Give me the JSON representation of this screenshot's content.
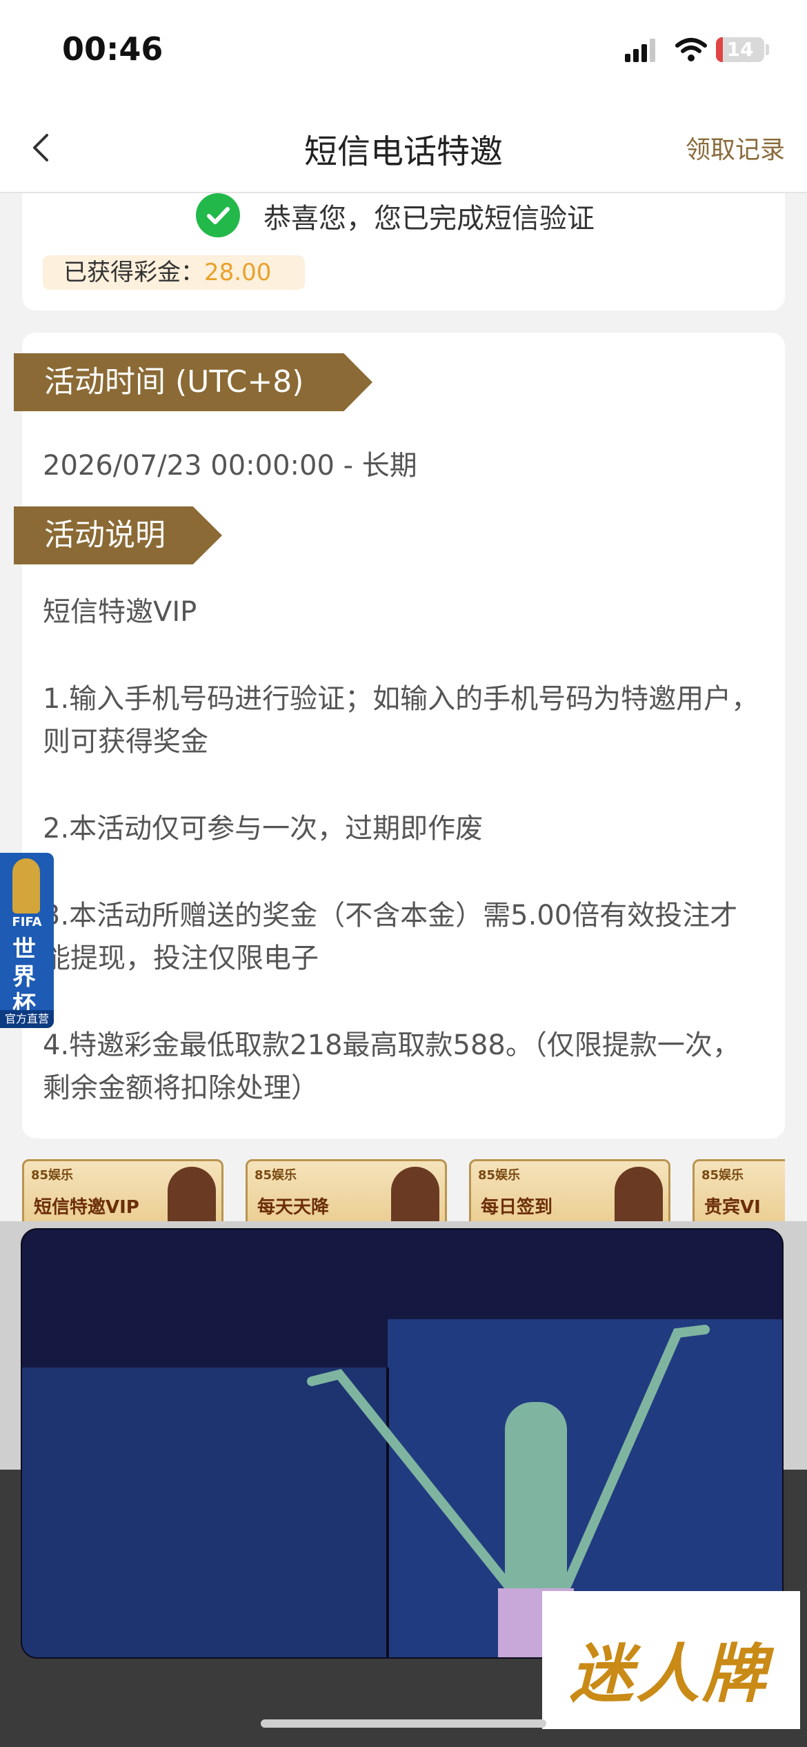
{
  "status_bar": {
    "time": "00:46",
    "battery": "14",
    "battery_level": 0.14
  },
  "nav": {
    "title": "短信电话特邀",
    "right_link": "领取记录"
  },
  "verification": {
    "message": "恭喜您，您已完成短信验证",
    "earned_label": "已获得彩金：",
    "earned_amount": "28.00"
  },
  "activity": {
    "time_heading": "活动时间 (UTC+8)",
    "time_range": "2026/07/23 00:00:00 - 长期",
    "desc_heading": "活动说明",
    "desc_lines": [
      "短信特邀VIP",
      "1.输入手机号码进行验证；如输入的手机号码为特邀用户，则可获得奖金",
      "2.本活动仅可参与一次，过期即作废",
      "3.本活动所赠送的奖金（不含本金）需5.00倍有效投注才能提现，投注仅限电子",
      "4.特邀彩金最低取款218最高取款588。（仅限提款一次，剩余金额将扣除处理）"
    ]
  },
  "floating_ad": {
    "label_top": "FIFA",
    "label_main": "世界杯",
    "label_bottom": "官方直营"
  },
  "banners": [
    {
      "brand": "85娱乐",
      "title": "短信特邀VIP"
    },
    {
      "brand": "85娱乐",
      "title": "每天天降"
    },
    {
      "brand": "85娱乐",
      "title": "每日签到"
    },
    {
      "brand": "85娱乐",
      "title": "贵宾VI"
    }
  ],
  "overlay": {
    "logo_text": "迷人牌"
  },
  "colors": {
    "accent": "#8b6a35",
    "amount": "#e9a12b",
    "check": "#22b94a"
  }
}
